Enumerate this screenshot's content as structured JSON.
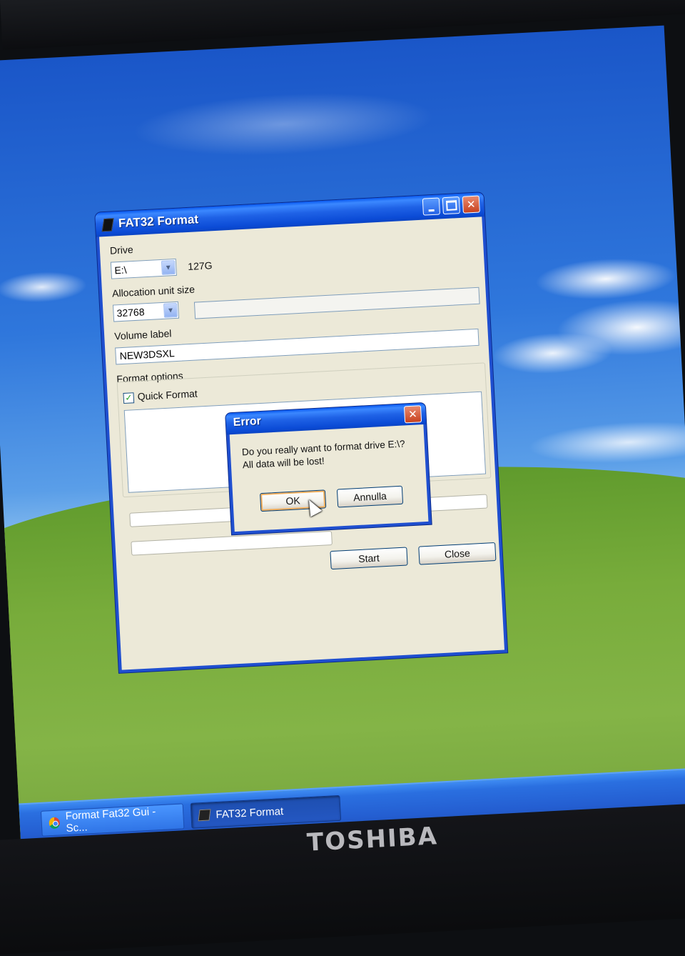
{
  "fat32_window": {
    "title": "FAT32 Format",
    "drive_label": "Drive",
    "drive_value": "E:\\",
    "drive_size": "127G",
    "alloc_label": "Allocation unit size",
    "alloc_value": "32768",
    "volume_label": "Volume label",
    "volume_value": "NEW3DSXL",
    "format_options_label": "Format options",
    "quick_format_label": "Quick Format",
    "quick_format_checked": true,
    "start_button": "Start",
    "close_button": "Close"
  },
  "error_dialog": {
    "title": "Error",
    "message_line1": "Do you really want to format drive E:\\?",
    "message_line2": "All data will be lost!",
    "ok_button": "OK",
    "cancel_button": "Annulla"
  },
  "taskbar": {
    "items": [
      {
        "label": "Format Fat32 Gui - Sc...",
        "icon": "chrome-icon",
        "active": false
      },
      {
        "label": "FAT32 Format",
        "icon": "fat32-format-icon",
        "active": true
      }
    ]
  },
  "laptop": {
    "brand": "TOSHIBA"
  },
  "colors": {
    "xp_title_blue": "#0b4bd6",
    "xp_face": "#ece9d8",
    "close_red": "#c8421f"
  }
}
